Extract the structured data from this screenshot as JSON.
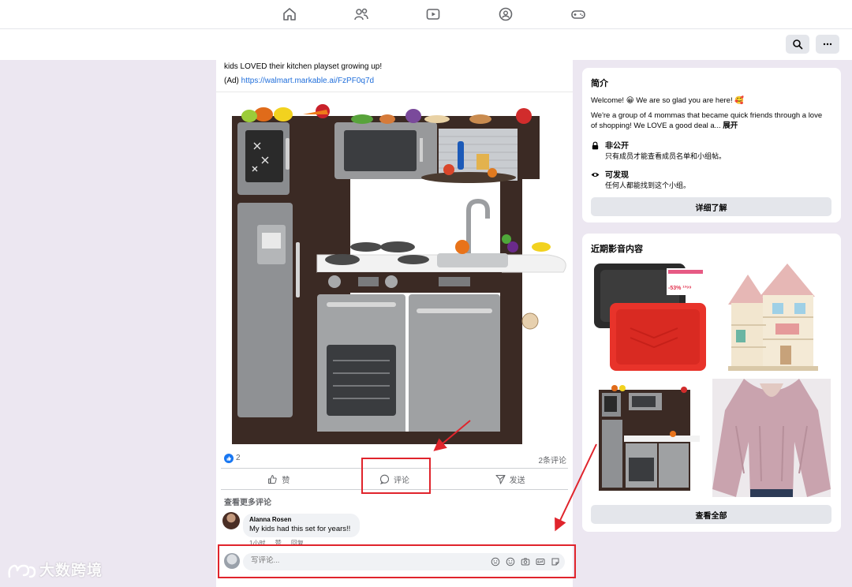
{
  "nav": {
    "icons": [
      "home-icon",
      "friends-icon",
      "watch-icon",
      "groups-icon",
      "gaming-icon"
    ]
  },
  "toolbar": {
    "search_icon": "search-icon",
    "more_icon": "more-icon"
  },
  "post": {
    "text_line": "kids LOVED their kitchen playset growing up!",
    "ad_prefix": "(Ad) ",
    "link": "https://walmart.markable.ai/FzPF0q7d",
    "reaction_count": "2",
    "comment_count": "2条评论",
    "actions": {
      "like": "赞",
      "comment": "评论",
      "share": "发送"
    },
    "view_more_comments": "查看更多评论",
    "comment": {
      "author": "Alanna Rosen",
      "text": "My kids had this set for years!!",
      "time": "1小时",
      "like": "赞",
      "reply": "回复"
    },
    "write_placeholder": "写评论..."
  },
  "sidebar": {
    "intro": {
      "title": "简介",
      "welcome": "Welcome! 😀 We are so glad you are here! 🥰",
      "description": "We're a group of 4 mommas that became quick friends through a love of shopping! We LOVE a good deal a...",
      "expand": "展开",
      "private_title": "非公开",
      "private_desc": "只有成员才能查看成员名单和小组帖。",
      "visible_title": "可发现",
      "visible_desc": "任何人都能找到这个小组。",
      "learn_more": "详细了解"
    },
    "media": {
      "title": "近期影音内容",
      "see_all": "查看全部",
      "tray_tag": "-53% ¹³⁹⁹"
    }
  },
  "watermark": {
    "text": "大数跨境"
  },
  "colors": {
    "accent": "#1877f2",
    "annotation": "#e0242c",
    "background": "#ece7f1"
  }
}
